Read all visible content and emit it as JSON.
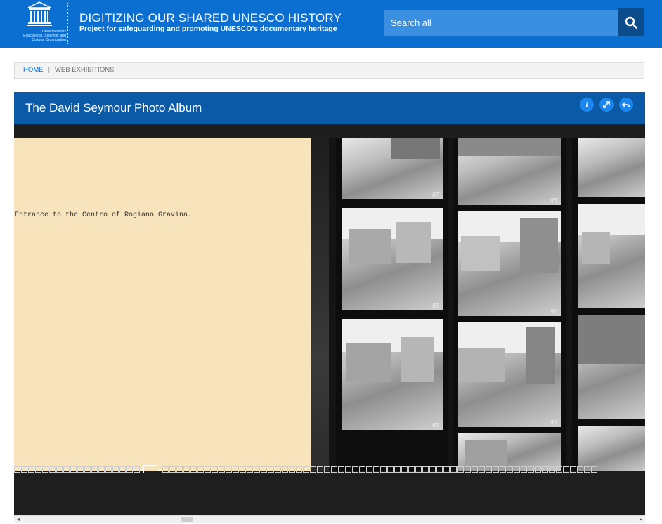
{
  "logo": {
    "text_lines": [
      "United Nations",
      "Educational, Scientific and",
      "Cultural Organization"
    ],
    "wordmark": "UNESCO"
  },
  "header": {
    "title": "DIGITIZING OUR SHARED UNESCO HISTORY",
    "subtitle": "Project for safeguarding and promoting UNESCO's documentary heritage"
  },
  "search": {
    "placeholder": "Search all",
    "button_icon": "search-icon"
  },
  "breadcrumb": {
    "home": "HOME",
    "separator": "|",
    "current": "WEB EXHIBITIONS"
  },
  "viewer": {
    "title": "The David Seymour Photo Album",
    "controls": {
      "info": "i",
      "info_icon": "info-icon",
      "fullscreen_icon": "expand-icon",
      "back_icon": "back-arrow-icon"
    },
    "left_page_caption": "Entrance to the Centro of Rogiano Gravina.",
    "frame_numbers": [
      "87",
      "86",
      "85",
      "96",
      "91",
      "90"
    ],
    "thumbnail_nav": {
      "prev_icon": "triangle-left-icon",
      "next_icon": "triangle-right-icon"
    }
  },
  "colors": {
    "brand_blue": "#0a6fd0",
    "search_button": "#0b4c8c",
    "viewer_header": "#0b5aa8",
    "paper": "#f7e4bd"
  }
}
